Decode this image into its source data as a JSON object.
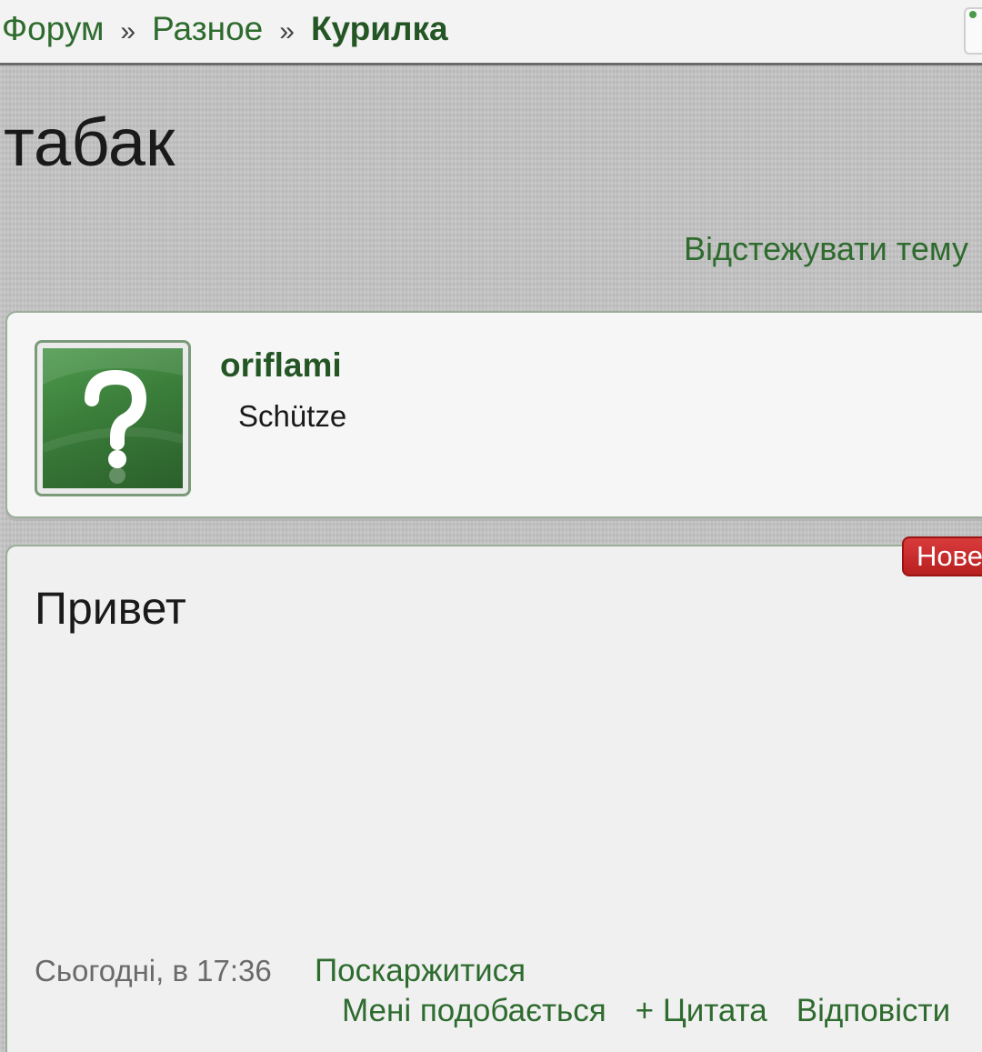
{
  "breadcrumb": {
    "items": [
      "Форум",
      "Разное"
    ],
    "separator": "»",
    "current": "Курилка"
  },
  "topic": {
    "title": "табак",
    "follow_label": "Відстежувати тему"
  },
  "author": {
    "name": "oriflami",
    "rank": "Schütze",
    "avatar_icon": "question-mark-icon"
  },
  "post": {
    "badge": "Нове",
    "text": "Привет",
    "date": "Сьогодні, в 17:36",
    "report_label": "Поскаржитися",
    "like_label": "Мені подобається",
    "quote_label": "+ Цитата",
    "reply_label": "Відповісти"
  },
  "colors": {
    "link_green": "#2e6b2e",
    "badge_red": "#c62828",
    "background": "#c4c4c4"
  }
}
